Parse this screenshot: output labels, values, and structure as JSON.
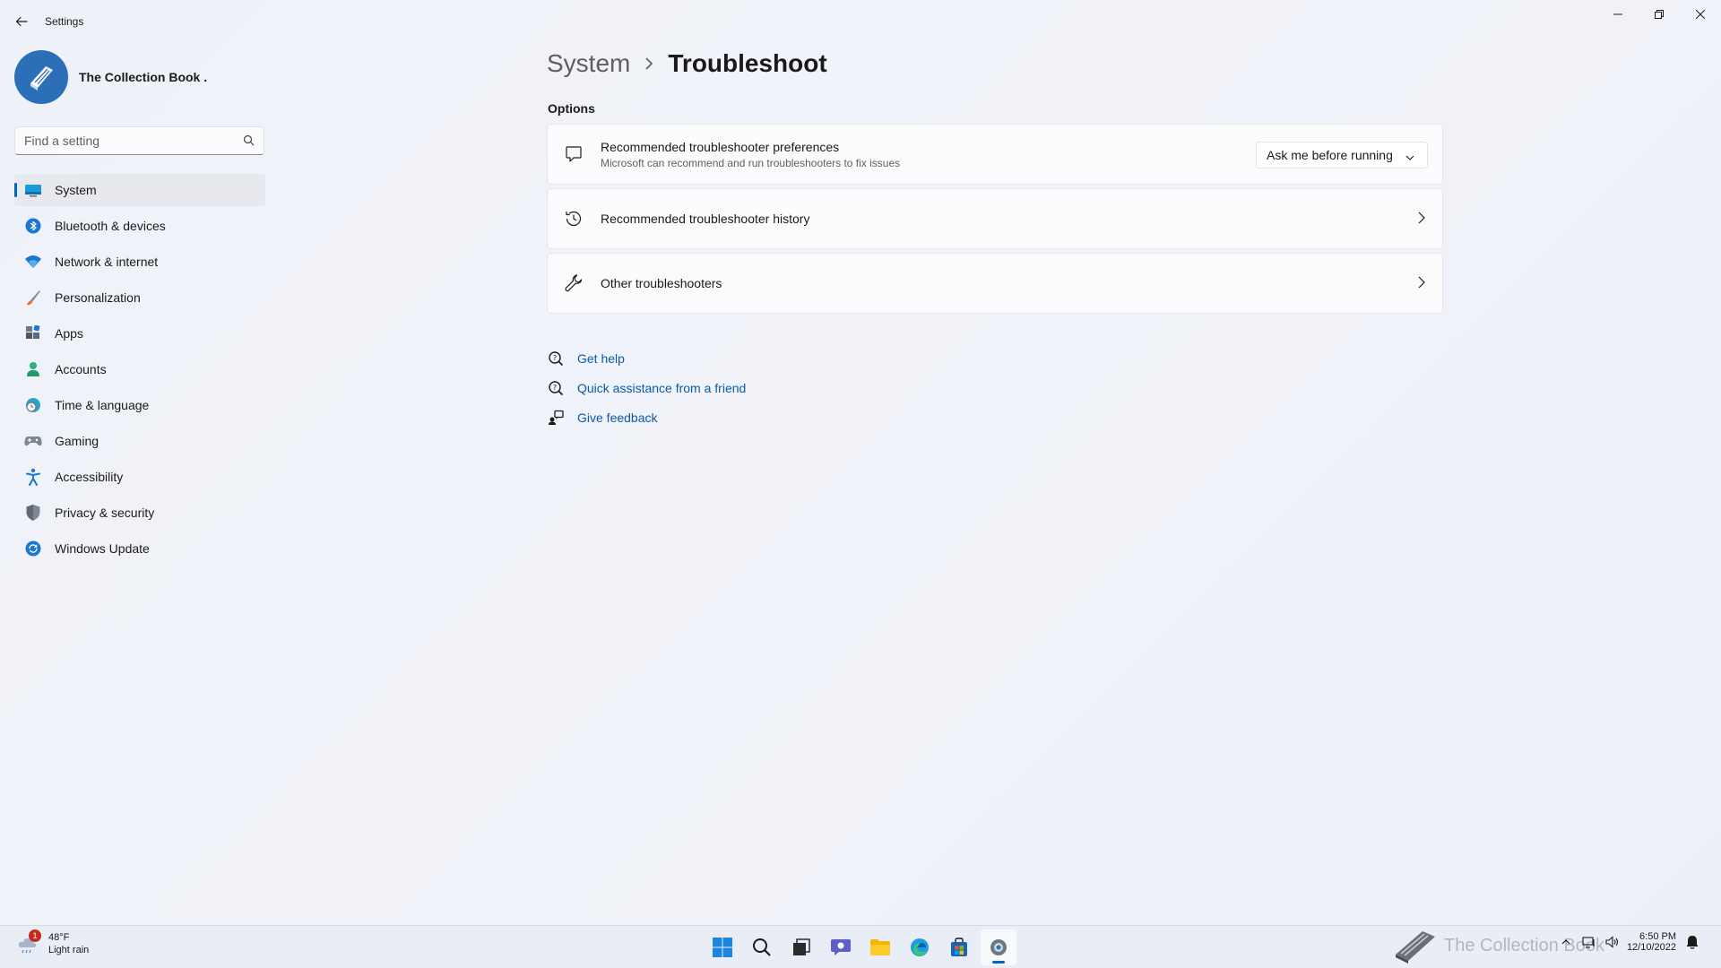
{
  "window": {
    "app_title": "Settings"
  },
  "profile": {
    "name": "The Collection Book ."
  },
  "search": {
    "placeholder": "Find a setting"
  },
  "sidebar": {
    "items": [
      {
        "label": "System",
        "icon": "system-icon",
        "active": true
      },
      {
        "label": "Bluetooth & devices",
        "icon": "bluetooth-icon"
      },
      {
        "label": "Network & internet",
        "icon": "wifi-icon"
      },
      {
        "label": "Personalization",
        "icon": "brush-icon"
      },
      {
        "label": "Apps",
        "icon": "apps-icon"
      },
      {
        "label": "Accounts",
        "icon": "person-icon"
      },
      {
        "label": "Time & language",
        "icon": "globe-clock-icon"
      },
      {
        "label": "Gaming",
        "icon": "controller-icon"
      },
      {
        "label": "Accessibility",
        "icon": "accessibility-icon"
      },
      {
        "label": "Privacy & security",
        "icon": "shield-icon"
      },
      {
        "label": "Windows Update",
        "icon": "update-icon"
      }
    ]
  },
  "breadcrumb": {
    "parent": "System",
    "current": "Troubleshoot"
  },
  "main": {
    "section_title": "Options",
    "cards": [
      {
        "title": "Recommended troubleshooter preferences",
        "subtitle": "Microsoft can recommend and run troubleshooters to fix issues",
        "icon": "chat-bubble-icon",
        "dropdown_value": "Ask me before running"
      },
      {
        "title": "Recommended troubleshooter history",
        "icon": "history-icon"
      },
      {
        "title": "Other troubleshooters",
        "icon": "wrench-icon"
      }
    ],
    "help_links": [
      {
        "label": "Get help",
        "icon": "help-icon"
      },
      {
        "label": "Quick assistance from a friend",
        "icon": "quick-assist-icon"
      },
      {
        "label": "Give feedback",
        "icon": "feedback-icon"
      }
    ]
  },
  "taskbar": {
    "weather": {
      "temp": "48°F",
      "condition": "Light rain",
      "badge": "1"
    },
    "apps": [
      "start-icon",
      "search-icon",
      "task-view-icon",
      "teams-chat-icon",
      "file-explorer-icon",
      "edge-icon",
      "store-icon",
      "settings-icon"
    ],
    "clock": {
      "time": "6:50 PM",
      "date": "12/10/2022"
    },
    "watermark": "The Collection Book"
  },
  "colors": {
    "accent": "#0067c0",
    "link": "#0a5aaa",
    "badge": "#c42b1c"
  }
}
